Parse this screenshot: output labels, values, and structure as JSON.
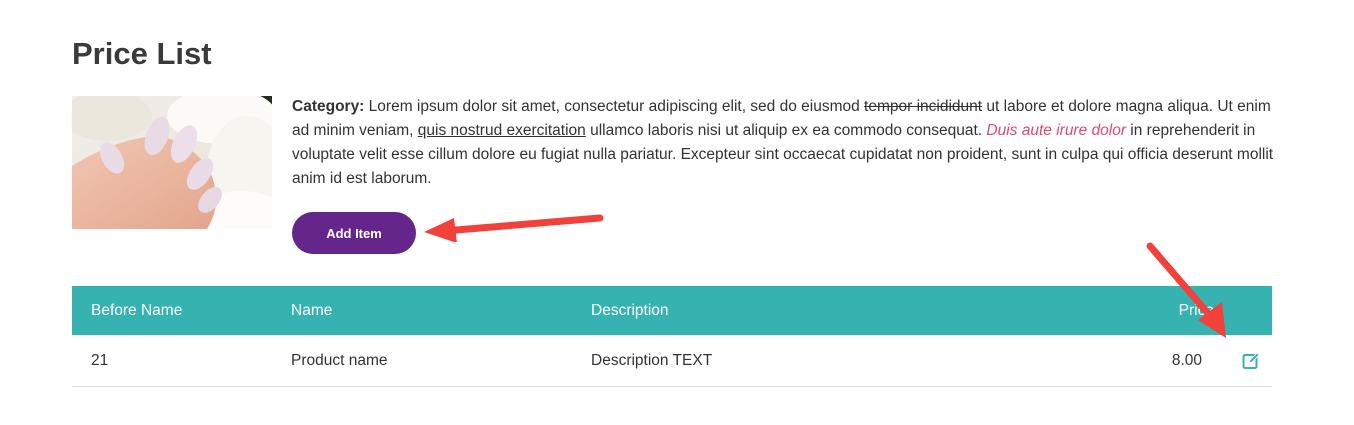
{
  "page": {
    "title": "Price List"
  },
  "category": {
    "label": "Category:",
    "text_1": " Lorem ipsum dolor sit amet, consectetur adipiscing elit, sed do eiusmod ",
    "strikethrough": "tempor incididunt",
    "text_2": " ut labore et dolore magna aliqua. Ut enim ad minim veniam, ",
    "underlined": "quis nostrud exercitation",
    "text_3": " ullamco laboris nisi ut aliquip ex ea commodo consequat. ",
    "emphasized": "Duis aute irure dolor",
    "text_4": " in reprehenderit in voluptate velit esse cillum dolore eu fugiat nulla pariatur. Excepteur sint occaecat cupidatat non proident, sunt in culpa qui officia deserunt mollit anim id est laborum."
  },
  "actions": {
    "add_item_label": "Add Item"
  },
  "table": {
    "headers": {
      "before_name": "Before Name",
      "name": "Name",
      "description": "Description",
      "price": "Price"
    },
    "rows": [
      {
        "before_name": "21",
        "name": "Product name",
        "description": "Description TEXT",
        "price": "8.00"
      }
    ]
  },
  "icons": {
    "edit": "edit-icon"
  },
  "colors": {
    "accent_teal": "#36b3b0",
    "button_purple": "#64268a",
    "emphasis_pink": "#e0496a",
    "annotation_red": "#f0413b"
  }
}
